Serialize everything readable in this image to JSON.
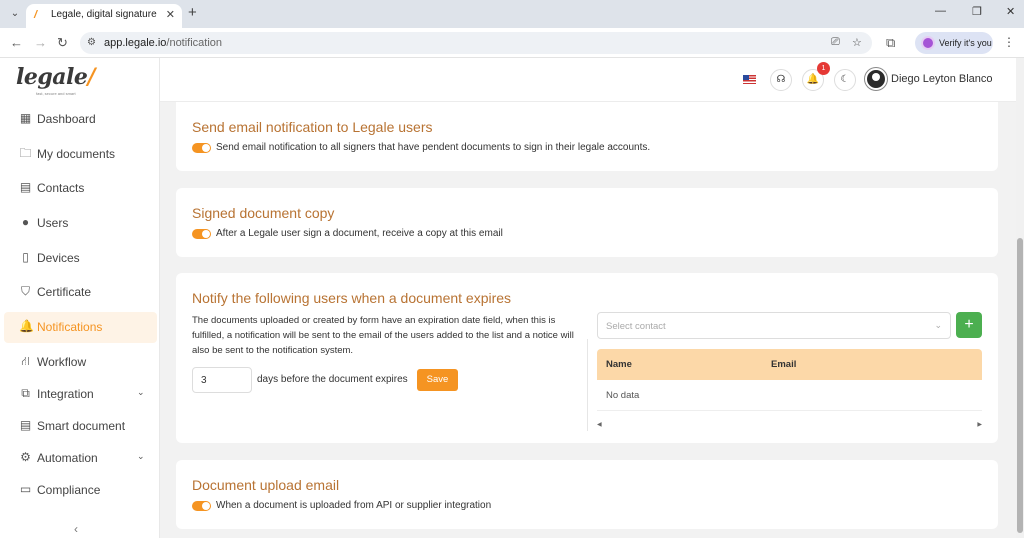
{
  "browser": {
    "tab_title": "Legale, digital signature",
    "url_host": "app.legale.io",
    "url_path": "/notification",
    "profile_label": "Verify it's you"
  },
  "logo": {
    "word": "legale",
    "tagline": "fast, secure and smart"
  },
  "sidebar": {
    "items": [
      {
        "label": "Dashboard",
        "icon": "dashboard-icon",
        "glyph": "▦"
      },
      {
        "label": "My documents",
        "icon": "folder-icon",
        "glyph": "🗀"
      },
      {
        "label": "Contacts",
        "icon": "contacts-icon",
        "glyph": "▤"
      },
      {
        "label": "Users",
        "icon": "user-icon",
        "glyph": "●"
      },
      {
        "label": "Devices",
        "icon": "device-icon",
        "glyph": "▯"
      },
      {
        "label": "Certificate",
        "icon": "shield-icon",
        "glyph": "⛉"
      },
      {
        "label": "Notifications",
        "icon": "bell-icon",
        "glyph": "🔔"
      },
      {
        "label": "Workflow",
        "icon": "workflow-icon",
        "glyph": "⛙"
      },
      {
        "label": "Integration",
        "icon": "external-link-icon",
        "glyph": "⧉"
      },
      {
        "label": "Smart document",
        "icon": "smart-document-icon",
        "glyph": "▤"
      },
      {
        "label": "Automation",
        "icon": "gear-icon",
        "glyph": "⚙"
      },
      {
        "label": "Compliance",
        "icon": "comment-icon",
        "glyph": "▭"
      }
    ],
    "active": "Notifications"
  },
  "topbar": {
    "notification_count": "1",
    "user_name": "Diego Leyton Blanco"
  },
  "cards": {
    "send_email": {
      "title": "Send email notification to Legale users",
      "toggle_label": "Send email notification to all signers that have pendent documents to sign in their legale accounts.",
      "enabled": true
    },
    "signed_copy": {
      "title": "Signed document copy",
      "toggle_label": "After a Legale user sign a document, receive a copy at this email",
      "enabled": true
    },
    "expiry": {
      "title": "Notify the following users when a document expires",
      "description": "The documents uploaded or created by form have an expiration date field, when this is fulfilled, a notification will be sent to the email of the users added to the list and a notice will also be sent to the notification system.",
      "days_value": "3",
      "days_label": "days before the document expires",
      "save_label": "Save",
      "select_placeholder": "Select contact",
      "add_label": "+",
      "table": {
        "columns": [
          "Name",
          "Email"
        ],
        "empty_text": "No data"
      }
    },
    "upload": {
      "title": "Document upload email",
      "toggle_label": "When a document is uploaded from API or supplier integration",
      "enabled": true
    }
  },
  "colors": {
    "accent": "#f59422",
    "title": "#b87333",
    "table_header": "#fcd8a8",
    "add_button": "#4caf50"
  }
}
